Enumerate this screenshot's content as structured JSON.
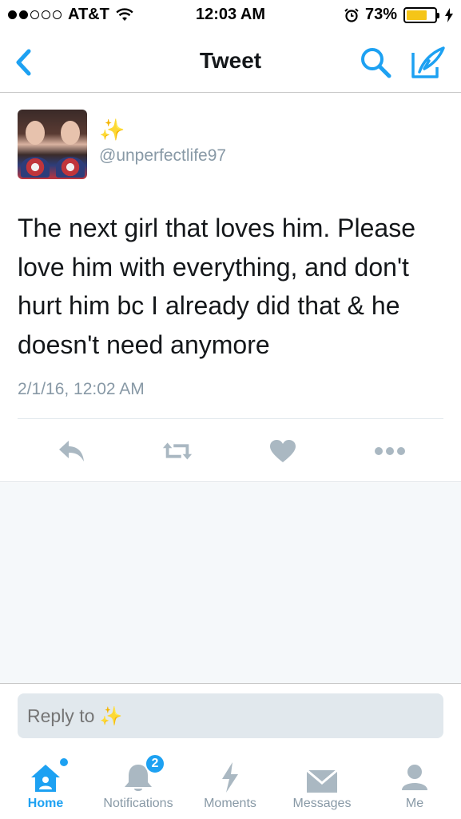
{
  "status_bar": {
    "carrier": "AT&T",
    "time": "12:03 AM",
    "battery_percent": "73%",
    "battery_level": 0.73,
    "signal_bars": 2
  },
  "nav": {
    "title": "Tweet"
  },
  "tweet": {
    "display_name": "✨",
    "handle": "@unperfectlife97",
    "text": "The next girl that loves him. Please love him with everything, and don't hurt him bc I already did that & he doesn't need anymore",
    "timestamp": "2/1/16, 12:02 AM"
  },
  "reply": {
    "placeholder": "Reply to ✨"
  },
  "tabs": [
    {
      "label": "Home",
      "icon": "home-icon",
      "active": true
    },
    {
      "label": "Notifications",
      "icon": "bell-icon",
      "badge": "2"
    },
    {
      "label": "Moments",
      "icon": "lightning-icon"
    },
    {
      "label": "Messages",
      "icon": "envelope-icon"
    },
    {
      "label": "Me",
      "icon": "person-icon"
    }
  ],
  "colors": {
    "accent": "#1da1f2",
    "secondary_text": "#8899a6",
    "icon_gray": "#aab8c2"
  }
}
